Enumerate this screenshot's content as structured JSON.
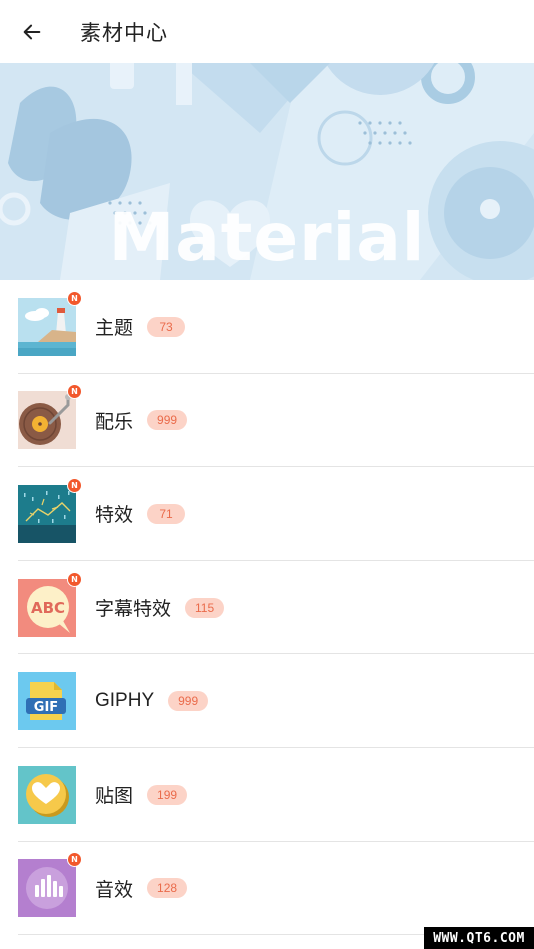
{
  "appbar": {
    "title": "素材中心",
    "back_icon": "arrow-left-icon"
  },
  "banner": {
    "text": "Material"
  },
  "items": [
    {
      "label": "主题",
      "count": "73",
      "icon": "theme-lighthouse-icon",
      "is_new": true,
      "new_text": "N"
    },
    {
      "label": "配乐",
      "count": "999",
      "icon": "music-record-icon",
      "is_new": true,
      "new_text": "N"
    },
    {
      "label": "特效",
      "count": "71",
      "icon": "effects-sparkle-icon",
      "is_new": true,
      "new_text": "N"
    },
    {
      "label": "字幕特效",
      "count": "115",
      "icon": "subtitle-abc-icon",
      "is_new": true,
      "new_text": "N"
    },
    {
      "label": "GIPHY",
      "count": "999",
      "icon": "gif-icon",
      "is_new": false,
      "new_text": ""
    },
    {
      "label": "贴图",
      "count": "199",
      "icon": "sticker-heart-icon",
      "is_new": false,
      "new_text": ""
    },
    {
      "label": "音效",
      "count": "128",
      "icon": "sound-wave-icon",
      "is_new": true,
      "new_text": "N"
    }
  ],
  "watermark": "WWW.QT6.COM",
  "colors": {
    "badge_bg": "#fcd3c7",
    "badge_text": "#ea6b4b",
    "new_dot": "#f2582c",
    "banner_bg": "#cfe3f1"
  }
}
